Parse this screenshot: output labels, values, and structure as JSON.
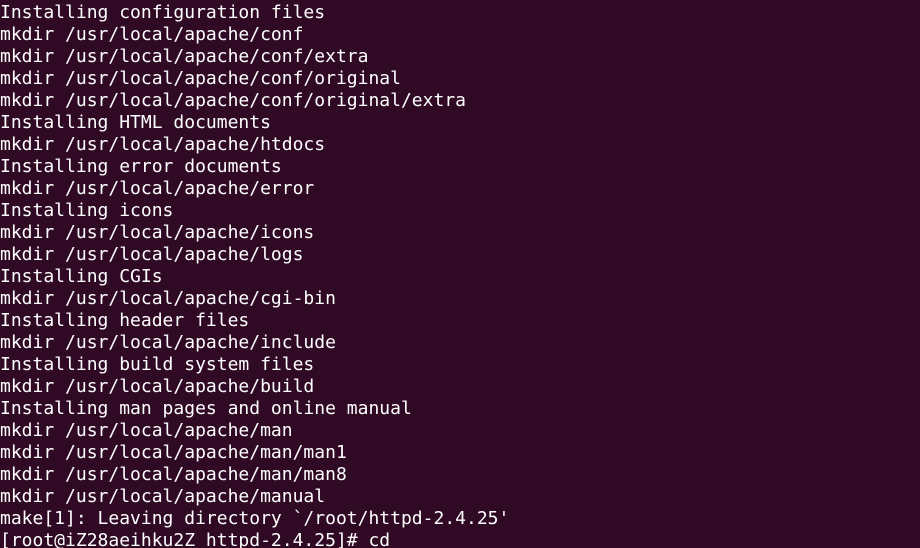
{
  "terminal": {
    "lines": [
      "Installing configuration files",
      "mkdir /usr/local/apache/conf",
      "mkdir /usr/local/apache/conf/extra",
      "mkdir /usr/local/apache/conf/original",
      "mkdir /usr/local/apache/conf/original/extra",
      "Installing HTML documents",
      "mkdir /usr/local/apache/htdocs",
      "Installing error documents",
      "mkdir /usr/local/apache/error",
      "Installing icons",
      "mkdir /usr/local/apache/icons",
      "mkdir /usr/local/apache/logs",
      "Installing CGIs",
      "mkdir /usr/local/apache/cgi-bin",
      "Installing header files",
      "mkdir /usr/local/apache/include",
      "Installing build system files",
      "mkdir /usr/local/apache/build",
      "Installing man pages and online manual",
      "mkdir /usr/local/apache/man",
      "mkdir /usr/local/apache/man/man1",
      "mkdir /usr/local/apache/man/man8",
      "mkdir /usr/local/apache/manual",
      "make[1]: Leaving directory `/root/httpd-2.4.25'"
    ],
    "prompt": "[root@iZ28aeihku2Z httpd-2.4.25]# ",
    "command": "cd"
  },
  "colors": {
    "background": "#300a24",
    "foreground": "#ffffff"
  }
}
